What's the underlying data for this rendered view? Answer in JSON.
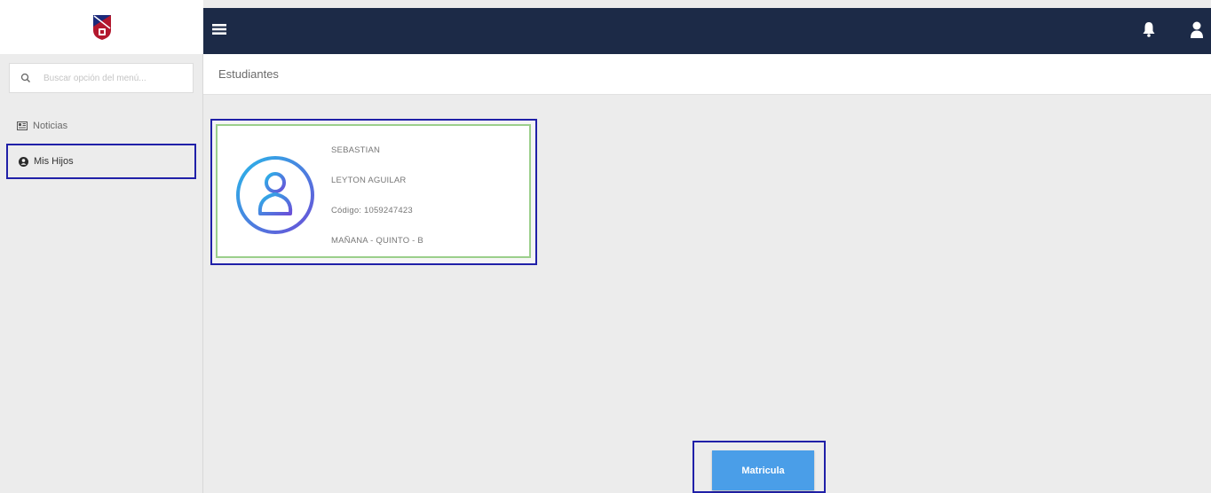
{
  "sidebar": {
    "search_placeholder": "Buscar opción del menú...",
    "items": [
      {
        "label": "Noticias",
        "icon": "newspaper-icon"
      },
      {
        "label": "Mis Hijos",
        "icon": "user-circle-icon"
      }
    ]
  },
  "topbar": {
    "icons": [
      "menu-icon",
      "bell-icon",
      "user-icon"
    ],
    "color": "#1c2a47"
  },
  "header": {
    "title": "Estudiantes"
  },
  "student": {
    "first_name": "SEBASTIAN",
    "last_name": "LEYTON AGUILAR",
    "code": "Código: 1059247423",
    "group": "MAÑANA - QUINTO - B"
  },
  "actions": {
    "matricula_label": "Matricula",
    "button_color": "#4a9ee8"
  }
}
